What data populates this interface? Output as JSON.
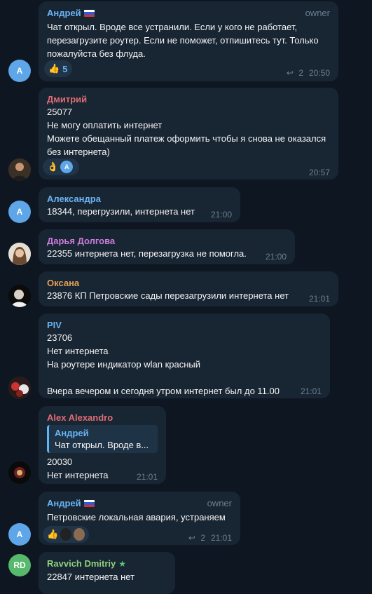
{
  "messages": [
    {
      "author": "Андрей",
      "badge": "owner",
      "text": "Чат открыл. Вроде все устранили. Если у кого не работает, перезагрузите роутер. Если не поможет, отпишитесь тут. Только пожалуйста без флуда.",
      "reaction": {
        "emoji": "👍",
        "count": "5"
      },
      "replies": "2",
      "time": "20:50",
      "avatar_letter": "А"
    },
    {
      "author": "Дмитрий",
      "text": "25077\nНе могу оплатить интернет\nМожете обещанный платеж оформить чтобы я снова не оказался без интернета)",
      "reaction": {
        "emoji": "👌",
        "avatar_letter": "А"
      },
      "time": "20:57"
    },
    {
      "author": "Александра",
      "text": "18344, перегрузили, интернета нет",
      "time": "21:00",
      "avatar_letter": "А"
    },
    {
      "author": "Дарья Долгова",
      "text": "22355 интернета нет, перезагрузка не помогла.",
      "time": "21:00"
    },
    {
      "author": "Оксана",
      "text": "23876 КП Петровские сады перезагрузили интернета нет",
      "time": "21:01"
    },
    {
      "author": "PIV",
      "text": "23706\nНет интернета\nНа роутере индикатор wlan красный\n\nВчера вечером и сегодня утром интернет был до 11.00",
      "time": "21:01"
    },
    {
      "author": "Alex Alexandro",
      "quote_author": "Андрей",
      "quote_text": "Чат открыл. Вроде в...",
      "text": "20030\nНет интернета",
      "time": "21:01"
    },
    {
      "author": "Андрей",
      "badge": "owner",
      "text": "Петровские локальная авария, устраняем",
      "reaction": {
        "emoji": "👍"
      },
      "replies": "2",
      "time": "21:01",
      "avatar_letter": "А"
    },
    {
      "author": "Ravvich Dmitriy",
      "text": "22847 интернета нет",
      "avatar_letter": "RD"
    }
  ],
  "colors": {
    "background": "#0e1621",
    "bubble": "#182533",
    "andrey": "#6ab3f3",
    "dmitriy": "#e06c75",
    "aleksandra": "#6ab3f3",
    "darya": "#c97cd9",
    "oksana": "#e5a254",
    "piv": "#6ab3f3",
    "alex": "#e06c75",
    "ravvich": "#8fd17a"
  }
}
